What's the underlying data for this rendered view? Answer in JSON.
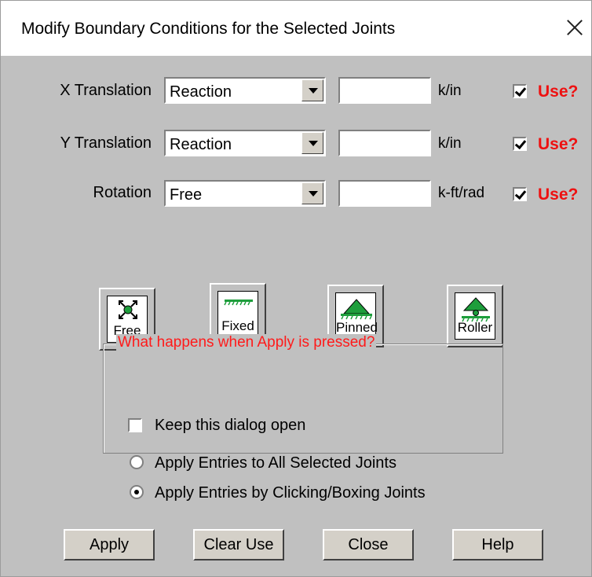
{
  "window": {
    "title": "Modify Boundary Conditions for the Selected Joints"
  },
  "rows": [
    {
      "label": "X Translation",
      "type": "Reaction",
      "value": "",
      "unit": "k/in",
      "use_checked": true,
      "use_label": "Use?"
    },
    {
      "label": "Y Translation",
      "type": "Reaction",
      "value": "",
      "unit": "k/in",
      "use_checked": true,
      "use_label": "Use?"
    },
    {
      "label": "Rotation",
      "type": "Free",
      "value": "",
      "unit": "k-ft/rad",
      "use_checked": true,
      "use_label": "Use?"
    }
  ],
  "presets": [
    {
      "label": "Free",
      "icon": "free-joint-icon"
    },
    {
      "label": "Fixed",
      "icon": "fixed-support-icon"
    },
    {
      "label": "Pinned",
      "icon": "pinned-support-icon"
    },
    {
      "label": "Roller",
      "icon": "roller-support-icon"
    }
  ],
  "apply_group": {
    "legend": "What happens when Apply is pressed?",
    "keep_open_label": "Keep this dialog open",
    "keep_open_checked": false,
    "options": [
      {
        "label": "Apply Entries to All Selected Joints",
        "selected": false
      },
      {
        "label": "Apply Entries by Clicking/Boxing Joints",
        "selected": true
      }
    ]
  },
  "buttons": {
    "apply": "Apply",
    "clear_use": "Clear Use",
    "close": "Close",
    "help": "Help"
  },
  "colors": {
    "dialog_bg": "#c0c0c0",
    "use_label": "#ee1111",
    "legend_text": "#ff1a1a",
    "support_green": "#1e9e3c"
  }
}
